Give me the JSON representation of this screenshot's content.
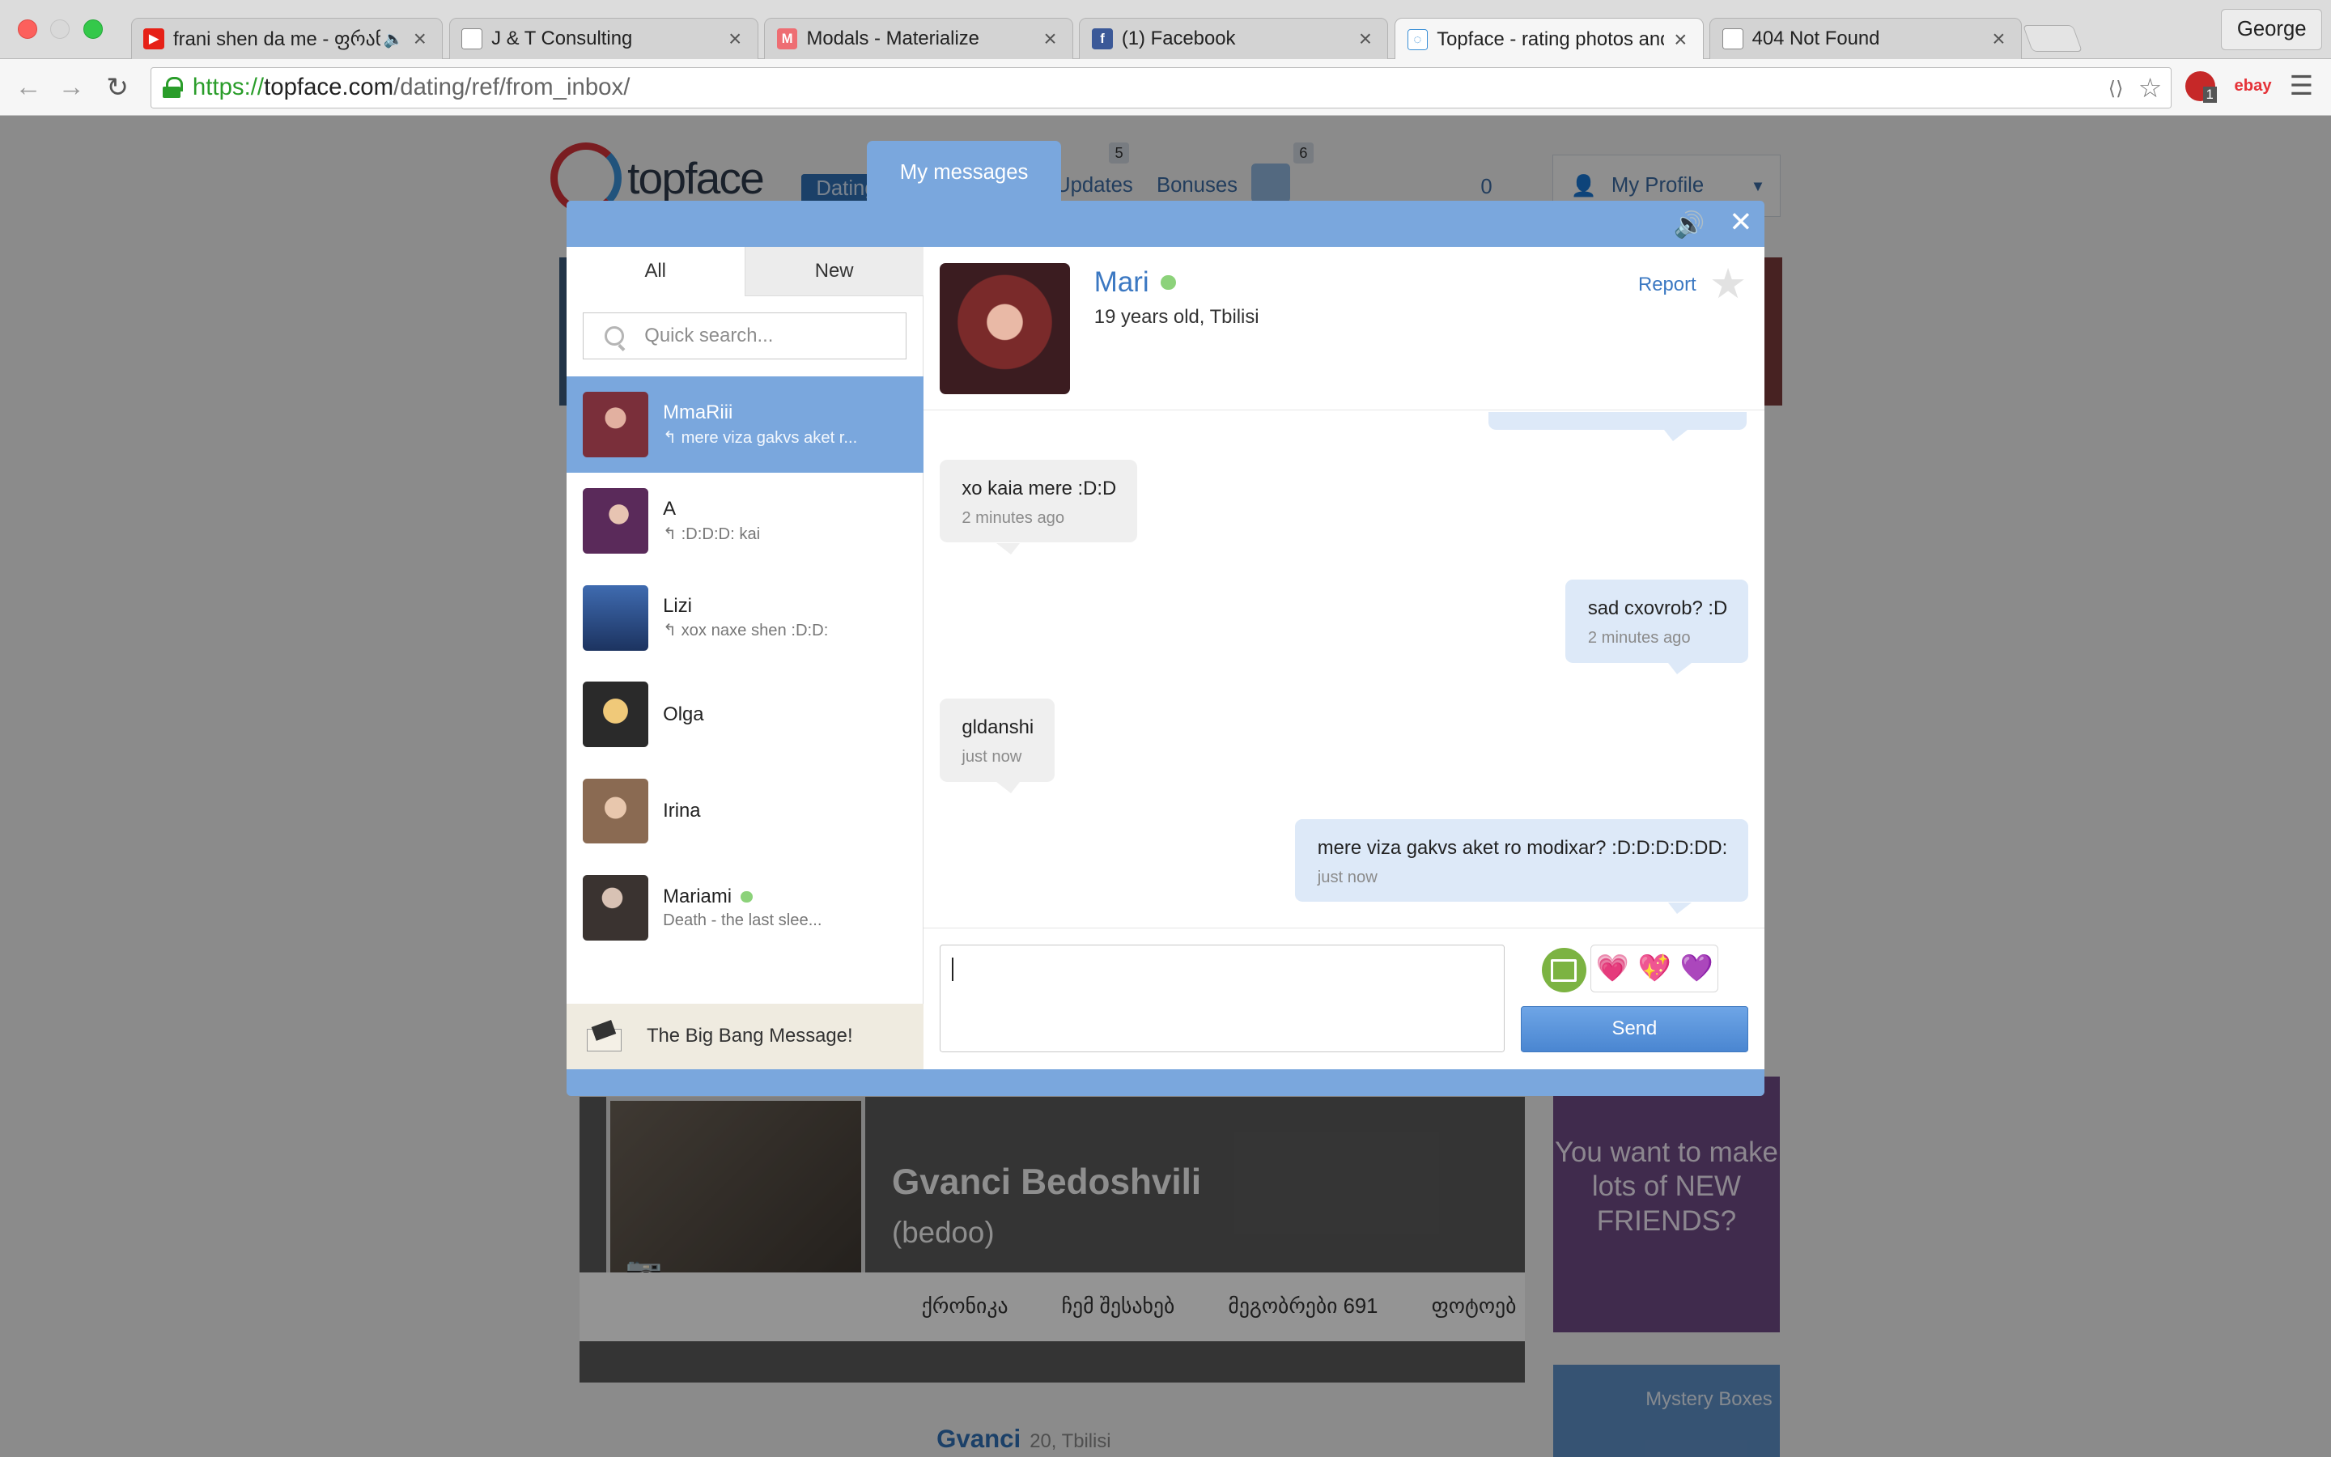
{
  "browser": {
    "tabs": [
      {
        "title": "frani shen da me - ფრან",
        "favicon_color": "#e62117",
        "favicon_glyph": "▶",
        "audio": "🔈",
        "active": false
      },
      {
        "title": "J & T Consulting",
        "favicon_color": "#ffffff",
        "favicon_glyph": "",
        "active": false
      },
      {
        "title": "Modals - Materialize",
        "favicon_color": "#ee6e73",
        "favicon_glyph": "M",
        "active": false
      },
      {
        "title": "(1) Facebook",
        "favicon_color": "#3b5998",
        "favicon_glyph": "f",
        "active": false
      },
      {
        "title": "Topface - rating photos and",
        "favicon_color": "#3a8fd6",
        "favicon_glyph": "◌",
        "active": true
      },
      {
        "title": "404 Not Found",
        "favicon_color": "#ffffff",
        "favicon_glyph": "",
        "active": false
      }
    ],
    "tab_close_glyph": "×",
    "profile_name": "George",
    "url": {
      "scheme": "https://",
      "host": "topface.com",
      "path": "/dating/ref/from_inbox/"
    },
    "ext_ebay": "ebay",
    "ext_badge": "1"
  },
  "site": {
    "logo_text": "topface",
    "nav": {
      "dating": "Dating",
      "updates": "Updates",
      "updates_count": "5",
      "bonuses": "Bonuses",
      "gifts_count": "6",
      "coins": "0",
      "my_profile": "My Profile"
    },
    "profile": {
      "name": "Gvanci Bedoshvili",
      "nick": "(bedoo)",
      "tabs": [
        "ქრონიკა",
        "ჩემ შესახებ",
        "მეგობრები 691",
        "ფოტოებ"
      ]
    },
    "ad_text": "You want to make lots of NEW FRIENDS?",
    "mystery_label": "Mystery Boxes",
    "footer_name": "Gvanci",
    "footer_meta": "20, Tbilisi"
  },
  "modal": {
    "tab_label": "My messages",
    "sound_icon": "🔊",
    "close_icon": "✕",
    "filters": {
      "all": "All",
      "new": "New"
    },
    "search_placeholder": "Quick search...",
    "reply_glyph": "↰",
    "conversations": [
      {
        "name": "MmaRiii",
        "snippet": "mere viza gakvs aket r...",
        "reply": true,
        "online": false,
        "selected": true,
        "avatar": "#7a2f3a"
      },
      {
        "name": "A",
        "snippet": ":D:D:D: kai",
        "reply": true,
        "online": false,
        "selected": false,
        "avatar": "#5a2a5a"
      },
      {
        "name": "Lizi",
        "snippet": "xox naxe shen :D:D:",
        "reply": true,
        "online": false,
        "selected": false,
        "avatar": "#2b4f8a"
      },
      {
        "name": "Olga",
        "snippet": "",
        "reply": false,
        "online": false,
        "selected": false,
        "avatar": "#c49a3a"
      },
      {
        "name": "Irina",
        "snippet": "",
        "reply": false,
        "online": false,
        "selected": false,
        "avatar": "#8a6a52"
      },
      {
        "name": "Mariami",
        "snippet": "Death - the last slee...",
        "reply": false,
        "online": true,
        "selected": false,
        "avatar": "#3a3330"
      }
    ],
    "bigbang_label": "The Big Bang Message!",
    "chat": {
      "name": "Mari",
      "subtitle": "19 years old, Tbilisi",
      "report": "Report",
      "star": "★",
      "messages": [
        {
          "dir": "in",
          "text": "xo kaia mere :D:D",
          "time": "2 minutes ago"
        },
        {
          "dir": "out",
          "text": "sad cxovrob? :D",
          "time": "2 minutes ago"
        },
        {
          "dir": "in",
          "text": "gldanshi",
          "time": "just now"
        },
        {
          "dir": "out",
          "text": "mere viza gakvs aket ro modixar? :D:D:D:D:DD:",
          "time": "just now"
        }
      ],
      "input_value": "",
      "stickers": [
        "💗",
        "💖",
        "💜"
      ],
      "send": "Send"
    }
  }
}
